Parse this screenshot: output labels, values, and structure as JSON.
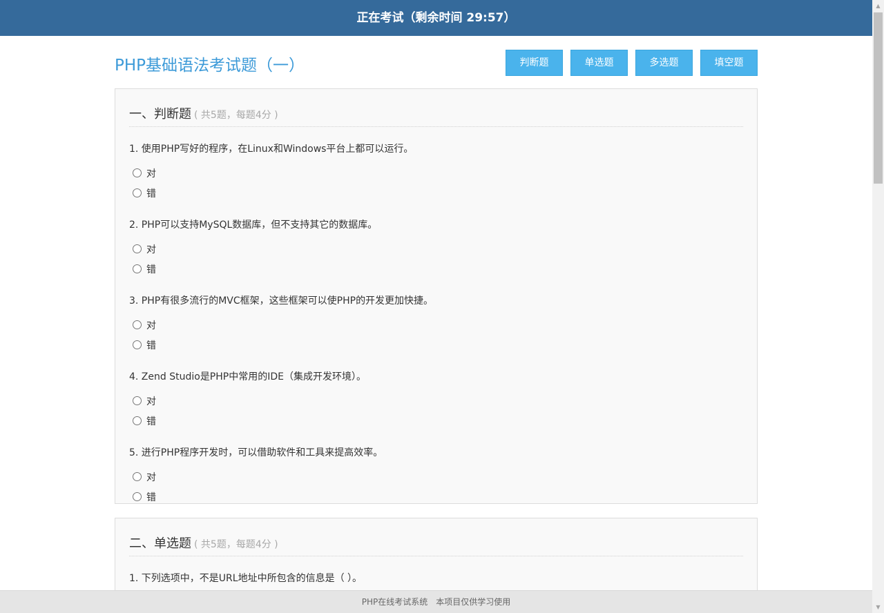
{
  "topbar": {
    "status": "正在考试（剩余时间 29:57）"
  },
  "header": {
    "title": "PHP基础语法考试题（一）",
    "nav": [
      "判断题",
      "单选题",
      "多选题",
      "填空题"
    ]
  },
  "sections": [
    {
      "title": "一、判断题",
      "note": "( 共5题，每题4分 )",
      "questions": [
        {
          "text": "1. 使用PHP写好的程序，在Linux和Windows平台上都可以运行。",
          "options": [
            "对",
            "错"
          ]
        },
        {
          "text": "2. PHP可以支持MySQL数据库，但不支持其它的数据库。",
          "options": [
            "对",
            "错"
          ]
        },
        {
          "text": "3. PHP有很多流行的MVC框架，这些框架可以使PHP的开发更加快捷。",
          "options": [
            "对",
            "错"
          ]
        },
        {
          "text": "4. Zend Studio是PHP中常用的IDE（集成开发环境）。",
          "options": [
            "对",
            "错"
          ]
        },
        {
          "text": "5. 进行PHP程序开发时，可以借助软件和工具来提高效率。",
          "options": [
            "对",
            "错"
          ]
        }
      ]
    },
    {
      "title": "二、单选题",
      "note": "( 共5题，每题4分 )",
      "questions": [
        {
          "text": "1. 下列选项中，不是URL地址中所包含的信息是（ ）。"
        }
      ]
    }
  ],
  "footer": {
    "system_name": "PHP在线考试系统",
    "notice": "本项目仅供学习使用"
  }
}
